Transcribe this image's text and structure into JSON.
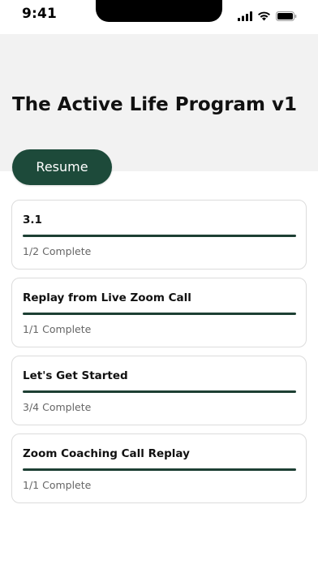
{
  "status_bar": {
    "time": "9:41",
    "icons": [
      "cellular-signal-icon",
      "wifi-icon",
      "battery-icon"
    ]
  },
  "program": {
    "title": "The Active Life Program v1",
    "resume_label": "Resume"
  },
  "colors": {
    "accent": "#1d4a3a",
    "progress": "#1d3f33",
    "header_bg": "#f2f2f2"
  },
  "modules": [
    {
      "title": "3.1",
      "status": "1/2 Complete",
      "progress": 1.0
    },
    {
      "title": "Replay from Live Zoom Call",
      "status": "1/1 Complete",
      "progress": 1.0
    },
    {
      "title": "Let's Get Started",
      "status": "3/4 Complete",
      "progress": 1.0
    },
    {
      "title": "Zoom Coaching Call Replay",
      "status": "1/1 Complete",
      "progress": 1.0
    }
  ]
}
